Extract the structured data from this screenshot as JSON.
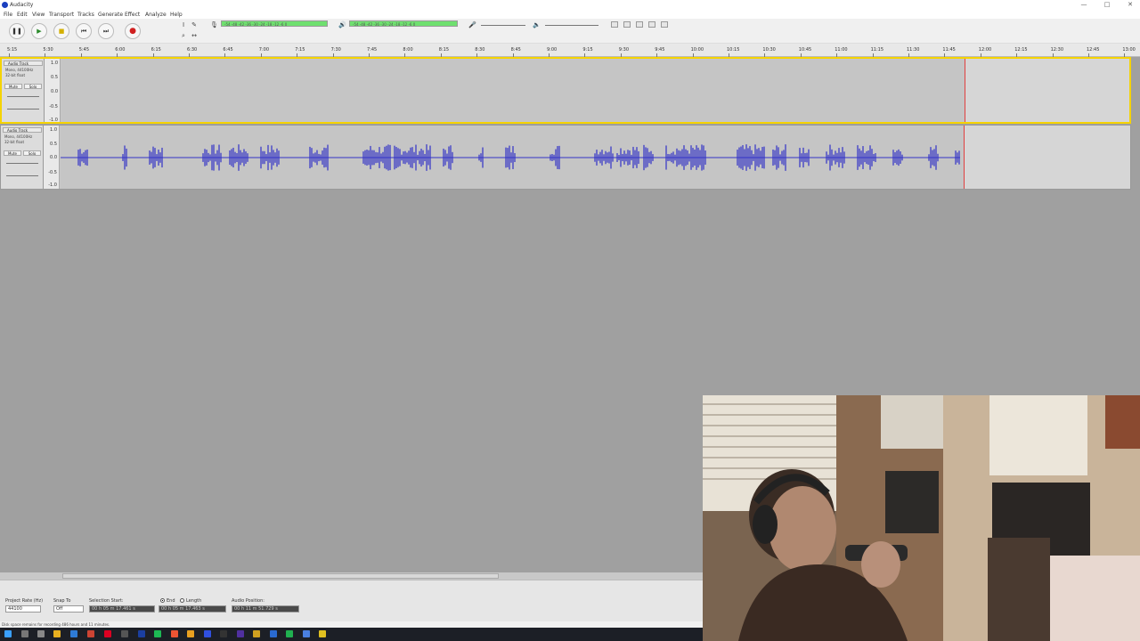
{
  "window": {
    "title": "Audacity",
    "controls": [
      "—",
      "□",
      "✕"
    ]
  },
  "menu": [
    "File",
    "Edit",
    "View",
    "Transport",
    "Tracks",
    "Generate",
    "Effect",
    "Analyze",
    "Help"
  ],
  "transport": {
    "pause": "❚❚",
    "play": "▶",
    "stop": "■",
    "skip_start": "⏮",
    "skip_end": "⏭",
    "record": "●"
  },
  "tools": [
    "I",
    "✎",
    "↔",
    "⌕",
    "✱",
    "∗"
  ],
  "meters": {
    "record_ticks": "-54  -48  -42  -36  -30  -24  -18  -12  -6  0",
    "play_ticks": "-54  -48  -42  -36  -30  -24  -18  -12  -6  0"
  },
  "ruler": {
    "labels": [
      "5:15",
      "5:30",
      "5:45",
      "6:00",
      "6:15",
      "6:30",
      "6:45",
      "7:00",
      "7:15",
      "7:30",
      "7:45",
      "8:00",
      "8:15",
      "8:30",
      "8:45",
      "9:00",
      "9:15",
      "9:30",
      "9:45",
      "10:00",
      "10:15",
      "10:30",
      "10:45",
      "11:00",
      "11:15",
      "11:30",
      "11:45",
      "12:00",
      "12:15",
      "12:30",
      "12:45",
      "13:00"
    ]
  },
  "tracks": [
    {
      "name": "Audio Track",
      "info": [
        "Mono, 44100Hz",
        "32-bit float"
      ],
      "mute": "Mute",
      "solo": "Solo",
      "scale": [
        "1.0",
        "0.5",
        "0.0",
        "-0.5",
        "-1.0"
      ]
    },
    {
      "name": "Audio Track",
      "info": [
        "Mono, 44100Hz",
        "32-bit float"
      ],
      "mute": "Mute",
      "solo": "Solo",
      "scale": [
        "1.0",
        "0.5",
        "0.0",
        "-0.5",
        "-1.0"
      ]
    }
  ],
  "selection_toolbar": {
    "project_rate_label": "Project Rate (Hz)",
    "project_rate_value": "44100",
    "snap_label": "Snap To",
    "snap_value": "Off",
    "selection_start_label": "Selection Start:",
    "end_label": "End",
    "length_label": "Length",
    "audio_position_label": "Audio Position:",
    "selection_start": "00 h 05 m 17.461 s",
    "selection_end": "00 h 05 m 17.463 s",
    "audio_position": "00 h 11 m 51.729 s"
  },
  "status": "Disk space remains for recording 486 hours and 11 minutes."
}
